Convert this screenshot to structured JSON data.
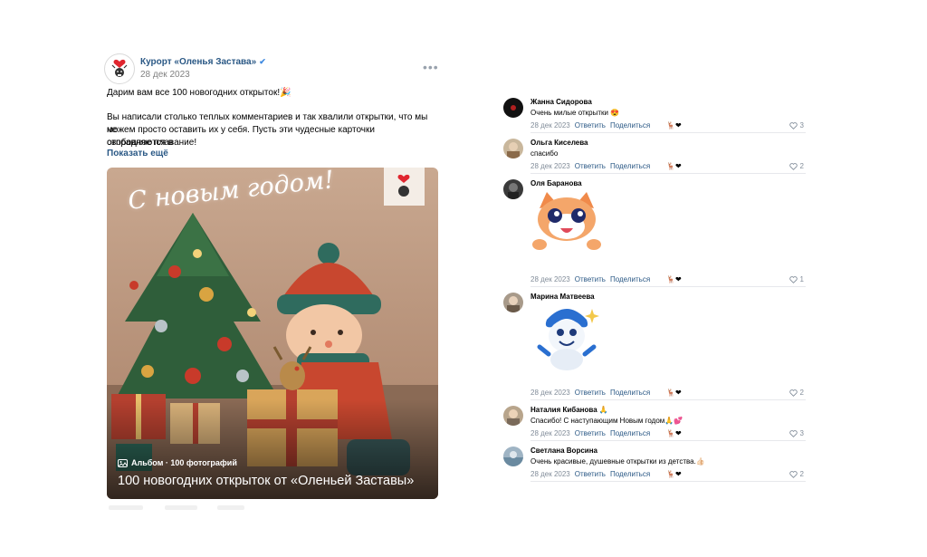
{
  "post": {
    "author": "Курорт «Оленья Застава»",
    "date": "28 дек 2023",
    "menu": "•••",
    "text_line1": "Дарим вам все 100 новогодних открыток!🎉",
    "text_para": [
      "Вы написали столько теплых комментариев и так хвалили открытки, что мы не",
      "можем просто оставить их у себя. Пусть эти чудесные карточки отправляются в",
      "свободное плавание!"
    ],
    "show_more": "Показать ещё",
    "album": {
      "meta": "Альбом · 100 фотографий",
      "title": "100 новогодних открыток от «Оленьей Заставы»",
      "greeting": "С новым годом!"
    }
  },
  "comments": [
    {
      "name": "Жанна Сидорова",
      "text": "Очень милые открытки 😍",
      "date": "28 дек 2023",
      "reply": "Ответить",
      "share": "Поделиться",
      "likes": "3",
      "avatar_color": "#1a1a1a",
      "sticker": ""
    },
    {
      "name": "Ольга Киселева",
      "text": "спасибо",
      "date": "28 дек 2023",
      "reply": "Ответить",
      "share": "Поделиться",
      "likes": "2",
      "avatar_color": "#c9b79c",
      "sticker": ""
    },
    {
      "name": "Оля Баранова",
      "text": "",
      "date": "28 дек 2023",
      "reply": "Ответить",
      "share": "Поделиться",
      "likes": "1",
      "avatar_color": "#3a3a3a",
      "sticker": "cat-sticker"
    },
    {
      "name": "Марина Матвеева",
      "text": "",
      "date": "28 дек 2023",
      "reply": "Ответить",
      "share": "Поделиться",
      "likes": "2",
      "avatar_color": "#a89a8a",
      "sticker": "snowman-sticker"
    },
    {
      "name": "Наталия Кибанова 🙏",
      "text": "Спасибо! С наступающим Новым годом🙏💕",
      "date": "28 дек 2023",
      "reply": "Ответить",
      "share": "Поделиться",
      "likes": "3",
      "avatar_color": "#b8a58c",
      "sticker": ""
    },
    {
      "name": "Светлана Ворсина",
      "text": "Очень красивые, душевные открытки из детства.👍🏻",
      "date": "28 дек 2023",
      "reply": "Ответить",
      "share": "Поделиться",
      "likes": "2",
      "avatar_color": "#9fb4c4",
      "sticker": ""
    }
  ],
  "colors": {
    "link": "#2a5885",
    "muted": "#818c99",
    "brand_red": "#e0262f"
  },
  "icons": {
    "verified": "verified-check-icon",
    "like": "heart-outline-icon",
    "album": "album-icon"
  }
}
